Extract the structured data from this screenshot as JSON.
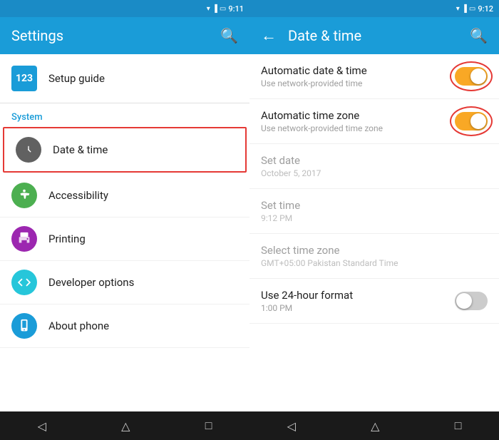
{
  "left_panel": {
    "status_bar": {
      "time": "9:11",
      "battery": "12%"
    },
    "app_bar": {
      "title": "Settings",
      "search_icon": "search"
    },
    "setup_guide": {
      "icon_text": "123",
      "label": "Setup guide"
    },
    "section_label": "System",
    "items": [
      {
        "id": "date-time",
        "title": "Date & time",
        "highlighted": true,
        "icon_color": "#616161",
        "icon_type": "clock"
      },
      {
        "id": "accessibility",
        "title": "Accessibility",
        "highlighted": false,
        "icon_color": "#4caf50",
        "icon_type": "accessibility"
      },
      {
        "id": "printing",
        "title": "Printing",
        "highlighted": false,
        "icon_color": "#9c27b0",
        "icon_type": "print"
      },
      {
        "id": "developer",
        "title": "Developer options",
        "highlighted": false,
        "icon_color": "#26c6da",
        "icon_type": "developer"
      },
      {
        "id": "about",
        "title": "About phone",
        "highlighted": false,
        "icon_color": "#1a9cd8",
        "icon_type": "phone"
      }
    ],
    "nav": {
      "back": "◁",
      "home": "△",
      "recents": "□"
    }
  },
  "right_panel": {
    "status_bar": {
      "time": "9:12",
      "battery": "12%"
    },
    "app_bar": {
      "title": "Date & time",
      "back_icon": "←",
      "search_icon": "search"
    },
    "items": [
      {
        "id": "auto-date-time",
        "title": "Automatic date & time",
        "subtitle": "Use network-provided time",
        "type": "toggle",
        "state": "on",
        "greyed": false
      },
      {
        "id": "auto-timezone",
        "title": "Automatic time zone",
        "subtitle": "Use network-provided time zone",
        "type": "toggle",
        "state": "on",
        "greyed": false
      },
      {
        "id": "set-date",
        "title": "Set date",
        "subtitle": "October 5, 2017",
        "type": "tap",
        "greyed": true
      },
      {
        "id": "set-time",
        "title": "Set time",
        "subtitle": "9:12 PM",
        "type": "tap",
        "greyed": true
      },
      {
        "id": "select-timezone",
        "title": "Select time zone",
        "subtitle": "GMT+05:00 Pakistan Standard Time",
        "type": "tap",
        "greyed": true
      },
      {
        "id": "24hour",
        "title": "Use 24-hour format",
        "subtitle": "1:00 PM",
        "type": "toggle",
        "state": "off",
        "greyed": false
      }
    ],
    "nav": {
      "back": "◁",
      "home": "△",
      "recents": "□"
    }
  }
}
